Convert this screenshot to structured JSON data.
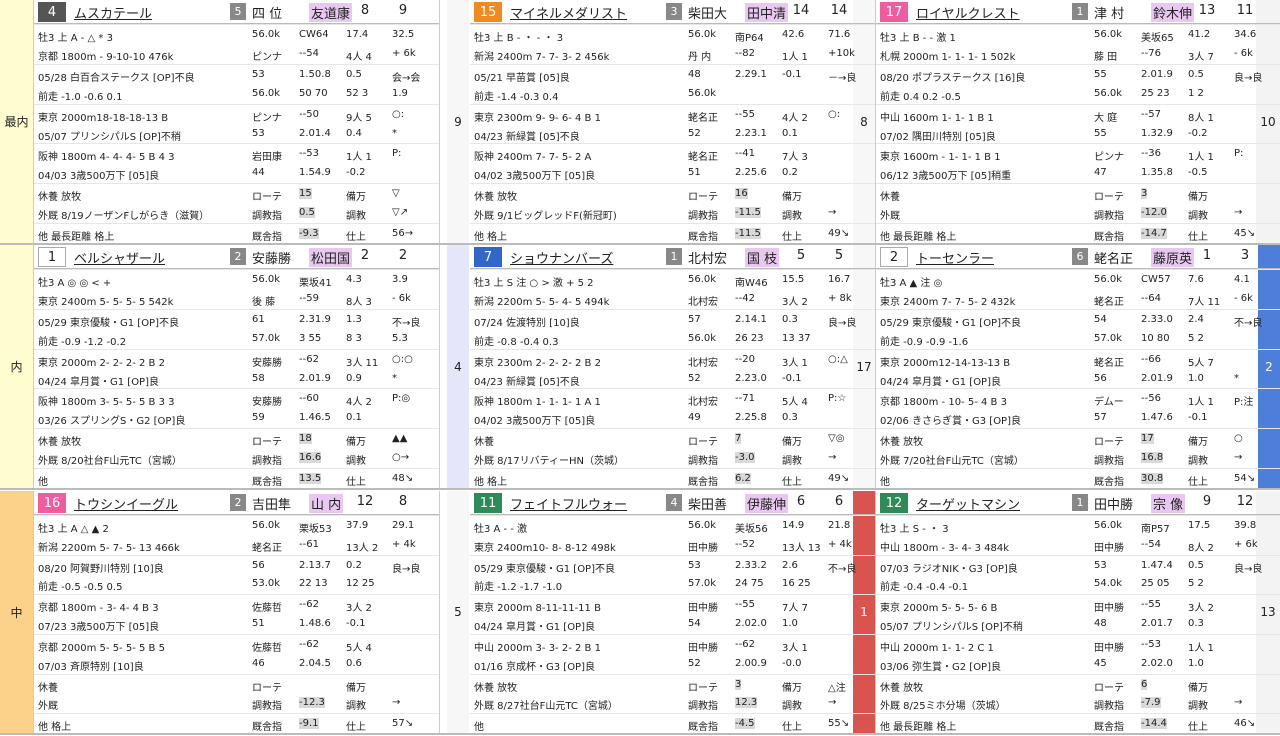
{
  "rows": [
    {
      "label": "最内",
      "right": "10",
      "bg": "#fffcd0",
      "cards": [
        {
          "badge": "4",
          "badge_bg": "#555",
          "name": "ムスカテール",
          "num": "5",
          "jockey": "四 位",
          "area": "友道康",
          "c1": "8",
          "c2": "9",
          "l1": "牡3  上 A - △  *  3",
          "l1b": "56.0k",
          "l1c": "CW64",
          "l1d": "17.4",
          "l1e": "32.5",
          "r1": "京都 1800m - 9-10-10 476k",
          "r1b": "ピンナ",
          "r1c": "--54",
          "r1d": "4人 4",
          "r1e": "+ 6k",
          "r1d2": "05/28 白百合ステークス [OP]不良",
          "r1b2": "53",
          "r1c2": "1.50.8",
          "r1d3": "0.5",
          "r1e2": "会→会",
          "p": "前走  -1.0  -0.6  0.1",
          "pb": "56.0k",
          "pc": "50 70",
          "pd": "52 3",
          "pe": "1.9",
          "r2": "東京 2000m18-18-18-13 B",
          "r2b": "ピンナ",
          "r2c": "--50",
          "r2d": "9人 5",
          "r2e": "○:",
          "r2d2": "05/07 プリンシパルS [OP]不稍",
          "r2b2": "53",
          "r2c2": "2.01.4",
          "r2d3": "0.4",
          "r2e2": "*",
          "r3": "阪神 1800m 4- 4- 4- 5 B 4 3",
          "r3b": "岩田康",
          "r3c": "--53",
          "r3d": "1人 1",
          "r3e": "P:",
          "r3d2": "04/03 3歳500万下 [05]良",
          "r3b2": "44",
          "r3c2": "1.54.9",
          "r3d3": "-0.2",
          "f1": "休養  放牧",
          "f1b": "ローテ",
          "f1c": "15",
          "f1d": "備万",
          "f1e": "▽",
          "f2": "外厩  8/19ノーザンFしがらき（滋賀）",
          "f2b": "調教指",
          "f2c": "0.5",
          "f2d": "調教",
          "f2e": "▽↗",
          "f3": "他  最長距離  格上",
          "f3b": "厩舎指",
          "f3c": "-9.3",
          "f3d": "仕上",
          "f3e": "56→"
        },
        {
          "badge": "15",
          "badge_bg": "#f08a1e",
          "name": "マイネルメダリスト",
          "num": "3",
          "jockey": "柴田大",
          "area": "田中清",
          "c1": "14",
          "c2": "14",
          "l1": "牡3  上 B - ・ - ・  3",
          "l1b": "56.0k",
          "l1c": "南P64",
          "l1d": "42.6",
          "l1e": "71.6",
          "r1": "新潟 2400m 7- 7- 3- 2 456k",
          "r1b": "丹 内",
          "r1c": "--82",
          "r1d": "1人 1",
          "r1e": "+10k",
          "r1d2": "05/21 早苗賞 [05]良",
          "r1b2": "48",
          "r1c2": "2.29.1",
          "r1d3": "-0.1",
          "r1e2": "－→良",
          "p": "前走  -1.4  -0.3  0.4",
          "pb": "56.0k",
          "pc": "",
          "pd": "",
          "pe": "",
          "r2": "東京 2300m 9- 9- 6- 4 B 1",
          "r2b": "蛯名正",
          "r2c": "--55",
          "r2d": "4人 2",
          "r2e": "○:",
          "r2d2": "04/23 新緑賞 [05]不良",
          "r2b2": "52",
          "r2c2": "2.23.1",
          "r2d3": "0.1",
          "r2e2": "",
          "r3": "阪神 2400m 7- 7- 5- 2 A",
          "r3b": "蛯名正",
          "r3c": "--41",
          "r3d": "7人 3",
          "r3e": "",
          "r3d2": "04/02 3歳500万下 [05]良",
          "r3b2": "51",
          "r3c2": "2.25.6",
          "r3d3": "0.2",
          "f1": "休養  放牧",
          "f1b": "ローテ",
          "f1c": "16",
          "f1d": "備万",
          "f1e": "",
          "f2": "外厩  9/1ビッグレッドF(新冠町)",
          "f2b": "調教指",
          "f2c": "-11.5",
          "f2d": "調教",
          "f2e": "→",
          "f3": "他  格上",
          "f3b": "厩舎指",
          "f3c": "-11.5",
          "f3d": "仕上",
          "f3e": "49↘"
        },
        {
          "badge": "17",
          "badge_bg": "#f15ca0",
          "name": "ロイヤルクレスト",
          "num": "1",
          "jockey": "津 村",
          "area": "鈴木伸",
          "c1": "13",
          "c2": "11",
          "l1": "牡3  上 B - - 激  1",
          "l1b": "56.0k",
          "l1c": "美坂65",
          "l1d": "41.2",
          "l1e": "34.6",
          "r1": "札幌 2000m 1- 1- 1- 1 502k",
          "r1b": "藤 田",
          "r1c": "--76",
          "r1d": "3人 7",
          "r1e": "- 6k",
          "r1d2": "08/20 ポプラステークス [16]良",
          "r1b2": "55",
          "r1c2": "2.01.9",
          "r1d3": "0.5",
          "r1e2": "良→良",
          "p": "前走  0.4  0.2  -0.5",
          "pb": "56.0k",
          "pc": "25 23",
          "pd": "1 2",
          "pe": "",
          "r2": "中山 1600m 1- 1- 1 B 1",
          "r2b": "大 庭",
          "r2c": "--57",
          "r2d": "8人 1",
          "r2e": "",
          "r2d2": "07/02 隅田川特別 [05]良",
          "r2b2": "55",
          "r2c2": "1.32.9",
          "r2d3": "-0.2",
          "r2e2": "",
          "r3": "東京 1600m - 1- 1- 1 B 1",
          "r3b": "ピンナ",
          "r3c": "--36",
          "r3d": "1人 1",
          "r3e": "P:",
          "r3d2": "06/12 3歳500万下 [05]稍重",
          "r3b2": "47",
          "r3c2": "1.35.8",
          "r3d3": "-0.5",
          "f1": "休養",
          "f1b": "ローテ",
          "f1c": "3",
          "f1d": "備万",
          "f1e": "",
          "f2": "外厩",
          "f2b": "調教指",
          "f2c": "-12.0",
          "f2d": "調教",
          "f2e": "→",
          "f3": "他  最長距離  格上",
          "f3b": "厩舎指",
          "f3c": "-14.7",
          "f3d": "仕上",
          "f3e": "45↘"
        }
      ],
      "gaps": [
        "9",
        "8"
      ]
    },
    {
      "label": "内",
      "right": "2",
      "bg": "#fffcd0",
      "cards": [
        {
          "badge": "1",
          "badge_bg": "#fff",
          "name": "ベルシャザール",
          "num": "2",
          "jockey": "安藤勝",
          "area": "松田国",
          "c1": "2",
          "c2": "2",
          "l1": "牡3  A ◎ ◎ <  +",
          "l1b": "56.0k",
          "l1c": "栗坂41",
          "l1d": "4.3",
          "l1e": "3.9",
          "r1": "東京 2400m 5- 5- 5- 5 542k",
          "r1b": "後 藤",
          "r1c": "--59",
          "r1d": "8人 3",
          "r1e": "- 6k",
          "r1d2": "05/29 東京優駿・G1 [OP]不良",
          "r1b2": "61",
          "r1c2": "2.31.9",
          "r1d3": "1.3",
          "r1e2": "不→良",
          "p": "前走  -0.9  -1.2  -0.2",
          "pb": "57.0k",
          "pc": "3 55",
          "pd": "8 3",
          "pe": "5.3",
          "r2": "東京 2000m 2- 2- 2- 2 B 2",
          "r2b": "安藤勝",
          "r2c": "--62",
          "r2d": "3人 11",
          "r2e": "○:○",
          "r2d2": "04/24 皐月賞・G1 [OP]良",
          "r2b2": "58",
          "r2c2": "2.01.9",
          "r2d3": "0.9",
          "r2e2": "*",
          "r3": "阪神 1800m 3- 5- 5- 5 B 3 3",
          "r3b": "安藤勝",
          "r3c": "--60",
          "r3d": "4人 2",
          "r3e": "P:◎",
          "r3d2": "03/26 スプリングS・G2 [OP]良",
          "r3b2": "59",
          "r3c2": "1.46.5",
          "r3d3": "0.1",
          "r3e2": "3.6",
          "f1": "休養  放牧",
          "f1b": "ローテ",
          "f1c": "18",
          "f1d": "備万",
          "f1e": "▲▲",
          "f2": "外厩  8/20社台F山元TC（宮城）",
          "f2b": "調教指",
          "f2c": "16.6",
          "f2d": "調教",
          "f2e": "○→",
          "f3": "他",
          "f3b": "厩舎指",
          "f3c": "13.5",
          "f3d": "仕上",
          "f3e": "48↘"
        },
        {
          "badge": "7",
          "badge_bg": "#3366cc",
          "name": "ショウナンバーズ",
          "num": "1",
          "jockey": "北村宏",
          "area": "国 枝",
          "c1": "5",
          "c2": "5",
          "l1": "牡3  上 S 注 ○ > 激 + 5  2",
          "l1b": "56.0k",
          "l1c": "南W46",
          "l1d": "15.5",
          "l1e": "16.7",
          "r1": "新潟 2200m 5- 5- 4- 5 494k",
          "r1b": "北村宏",
          "r1c": "--42",
          "r1d": "3人 2",
          "r1e": "+ 8k",
          "r1d2": "07/24 佐渡特別 [10]良",
          "r1b2": "57",
          "r1c2": "2.14.1",
          "r1d3": "0.3",
          "r1e2": "良→良",
          "p": "前走  -0.8  -0.4  0.3",
          "pb": "56.0k",
          "pc": "26 23",
          "pd": "13 37",
          "pe": "",
          "r2": "東京 2300m 2- 2- 2- 2 B 2",
          "r2b": "北村宏",
          "r2c": "--20",
          "r2d": "3人 1",
          "r2e": "○:△",
          "r2d2": "04/23 新緑賞 [05]不良",
          "r2b2": "52",
          "r2c2": "2.23.0",
          "r2d3": "-0.1",
          "r2e2": "",
          "r3": "阪神 1800m 1- 1- 1- 1 A 1",
          "r3b": "北村宏",
          "r3c": "--71",
          "r3d": "5人 4",
          "r3e": "P:☆",
          "r3d2": "04/02 3歳500万下 [05]良",
          "r3b2": "49",
          "r3c2": "2.25.8",
          "r3d3": "0.3",
          "f1": "休養",
          "f1b": "ローテ",
          "f1c": "7",
          "f1d": "備万",
          "f1e": "▽◎",
          "f2": "外厩  8/17リバティーHN（茨城）",
          "f2b": "調教指",
          "f2c": "-3.0",
          "f2d": "調教",
          "f2e": "→",
          "f3": "他  格上",
          "f3b": "厩舎指",
          "f3c": "6.2",
          "f3d": "仕上",
          "f3e": "49↘"
        },
        {
          "badge": "2",
          "badge_bg": "#fff",
          "name": "トーセンラー",
          "num": "6",
          "jockey": "蛯名正",
          "area": "藤原英",
          "c1": "1",
          "c2": "3",
          "l1": "牡3  A ▲ 注  ◎",
          "l1b": "56.0k",
          "l1c": "CW57",
          "l1d": "7.6",
          "l1e": "4.1",
          "r1": "東京 2400m 7- 7- 5- 2 432k",
          "r1b": "蛯名正",
          "r1c": "--64",
          "r1d": "7人 11",
          "r1e": "- 6k",
          "r1d2": "05/29 東京優駿・G1 [OP]不良",
          "r1b2": "54",
          "r1c2": "2.33.0",
          "r1d3": "2.4",
          "r1e2": "不→良",
          "p": "前走  -0.9  -0.9  -1.6",
          "pb": "57.0k",
          "pc": "10 80",
          "pd": "5 2",
          "pe": "",
          "r2": "東京 2000m12-14-13-13 B",
          "r2b": "蛯名正",
          "r2c": "--66",
          "r2d": "5人 7",
          "r2e": "",
          "r2d2": "04/24 皐月賞・G1 [OP]良",
          "r2b2": "56",
          "r2c2": "2.01.9",
          "r2d3": "1.0",
          "r2e2": "*",
          "r3": "京都 1800m - 10- 5- 4 B 3",
          "r3b": "デムー",
          "r3c": "--56",
          "r3d": "1人 1",
          "r3e": "P:注",
          "r3d2": "02/06 きさらぎ賞・G3 [OP]良",
          "r3b2": "57",
          "r3c2": "1.47.6",
          "r3d3": "-0.1",
          "r3e2": "",
          "f1": "休養  放牧",
          "f1b": "ローテ",
          "f1c": "17",
          "f1d": "備万",
          "f1e": "○",
          "f2": "外厩  7/20社台F山元TC（宮城）",
          "f2b": "調教指",
          "f2c": "16.8",
          "f2d": "調教",
          "f2e": "→",
          "f3": "他",
          "f3b": "厩舎指",
          "f3c": "30.8",
          "f3d": "仕上",
          "f3e": "54↘"
        }
      ],
      "gaps": [
        "4",
        "17"
      ]
    },
    {
      "label": "中",
      "right": "13",
      "bg": "#fcd18a",
      "cards": [
        {
          "badge": "16",
          "badge_bg": "#f15ca0",
          "name": "トウシンイーグル",
          "num": "2",
          "jockey": "吉田隼",
          "area": "山 内",
          "c1": "12",
          "c2": "8",
          "l1": "牡3  上 A △ ▲  2",
          "l1b": "56.0k",
          "l1c": "栗坂53",
          "l1d": "37.9",
          "l1e": "29.1",
          "r1": "新潟 2200m 5- 7- 5- 13 466k",
          "r1b": "蛯名正",
          "r1c": "--61",
          "r1d": "13人 2",
          "r1e": "+ 4k",
          "r1d2": "08/20 阿賀野川特別 [10]良",
          "r1b2": "56",
          "r1c2": "2.13.7",
          "r1d3": "0.2",
          "r1e2": "良→良",
          "p": "前走  -0.5  -0.5  0.5",
          "pb": "53.0k",
          "pc": "22 13",
          "pd": "12 25",
          "pe": "",
          "r2": "京都 1800m - 3- 4- 4 B 3",
          "r2b": "佐藤哲",
          "r2c": "--62",
          "r2d": "3人 2",
          "r2e": "",
          "r2d2": "07/23 3歳500万下 [05]良",
          "r2b2": "51",
          "r2c2": "1.48.6",
          "r2d3": "-0.1",
          "r2e2": "",
          "r3": "京都 2000m 5- 5- 5- 5 B 5",
          "r3b": "佐藤哲",
          "r3c": "--62",
          "r3d": "5人 4",
          "r3e": "",
          "r3d2": "07/03 斉原特別 [10]良",
          "r3b2": "46",
          "r3c2": "2.04.5",
          "r3d3": "0.6",
          "f1": "休養",
          "f1b": "ローテ",
          "f1c": "",
          "f1d": "備万",
          "f1e": "",
          "f2": "外厩",
          "f2b": "調教指",
          "f2c": "-12.3",
          "f2d": "調教",
          "f2e": "→",
          "f3": "他  格上",
          "f3b": "厩舎指",
          "f3c": "-9.1",
          "f3d": "仕上",
          "f3e": "57↘"
        },
        {
          "badge": "11",
          "badge_bg": "#2e8b57",
          "name": "フェイトフルウォー",
          "num": "4",
          "jockey": "柴田善",
          "area": "伊藤伸",
          "c1": "6",
          "c2": "6",
          "l1": "牡3  A - - 激",
          "l1b": "56.0k",
          "l1c": "美坂56",
          "l1d": "14.9",
          "l1e": "21.8",
          "r1": "東京 2400m10- 8- 8-12 498k",
          "r1b": "田中勝",
          "r1c": "--52",
          "r1d": "13人 13",
          "r1e": "+ 4k",
          "r1d2": "05/29 東京優駿・G1 [OP]不良",
          "r1b2": "53",
          "r1c2": "2.33.2",
          "r1d3": "2.6",
          "r1e2": "不→良",
          "p": "前走  -1.2  -1.7  -1.0",
          "pb": "57.0k",
          "pc": "24 75",
          "pd": "16 25",
          "pe": "",
          "r2": "東京 2000m 8-11-11-11 B",
          "r2b": "田中勝",
          "r2c": "--55",
          "r2d": "7人 7",
          "r2e": "",
          "r2d2": "04/24 皐月賞・G1 [OP]良",
          "r2b2": "54",
          "r2c2": "2.02.0",
          "r2d3": "1.0",
          "r2e2": "",
          "r3": "中山 2000m 3- 3- 2- 2 B 1",
          "r3b": "田中勝",
          "r3c": "--62",
          "r3d": "3人 1",
          "r3e": "",
          "r3d2": "01/16 京成杯・G3 [OP]良",
          "r3b2": "52",
          "r3c2": "2.00.9",
          "r3d3": "-0.0",
          "f1": "休養  放牧",
          "f1b": "ローテ",
          "f1c": "3",
          "f1d": "備万",
          "f1e": "△注",
          "f2": "外厩  8/27社台F山元TC（宮城）",
          "f2b": "調教指",
          "f2c": "12.3",
          "f2d": "調教",
          "f2e": "→",
          "f3": "他",
          "f3b": "厩舎指",
          "f3c": "-4.5",
          "f3d": "仕上",
          "f3e": "55↘"
        },
        {
          "badge": "12",
          "badge_bg": "#2e8b57",
          "name": "ターゲットマシン",
          "num": "1",
          "jockey": "田中勝",
          "area": "宗 像",
          "c1": "9",
          "c2": "12",
          "l1": "牡3  上 S - ・  3",
          "l1b": "56.0k",
          "l1c": "南P57",
          "l1d": "17.5",
          "l1e": "39.8",
          "r1": "中山 1800m - 3- 4- 3 484k",
          "r1b": "田中勝",
          "r1c": "--54",
          "r1d": "8人 2",
          "r1e": "+ 6k",
          "r1d2": "07/03 ラジオNIK・G3 [OP]良",
          "r1b2": "53",
          "r1c2": "1.47.4",
          "r1d3": "0.5",
          "r1e2": "良→良",
          "p": "前走  -0.4  -0.4  -0.1",
          "pb": "54.0k",
          "pc": "25 05",
          "pd": "5 2",
          "pe": "",
          "r2": "東京 2000m 5- 5- 5- 6 B",
          "r2b": "田中勝",
          "r2c": "--55",
          "r2d": "3人 2",
          "r2e": "",
          "r2d2": "05/07 プリンシパルS [OP]不稍",
          "r2b2": "48",
          "r2c2": "2.01.7",
          "r2d3": "0.3",
          "r2e2": "",
          "r3": "中山 2000m 1- 1- 2 C 1",
          "r3b": "田中勝",
          "r3c": "--53",
          "r3d": "1人 1",
          "r3e": "",
          "r3d2": "03/06 弥生賞・G2 [OP]良",
          "r3b2": "45",
          "r3c2": "2.02.0",
          "r3d3": "1.0",
          "f1": "休養  放牧",
          "f1b": "ローテ",
          "f1c": "6",
          "f1d": "備万",
          "f1e": "",
          "f2": "外厩  8/25ミホ分場（茨城）",
          "f2b": "調教指",
          "f2c": "-7.9",
          "f2d": "調教",
          "f2e": "→",
          "f3": "他  最長距離  格上",
          "f3b": "厩舎指",
          "f3c": "-14.4",
          "f3d": "仕上",
          "f3e": "46↘"
        }
      ],
      "gaps": [
        "5",
        "1"
      ]
    }
  ]
}
